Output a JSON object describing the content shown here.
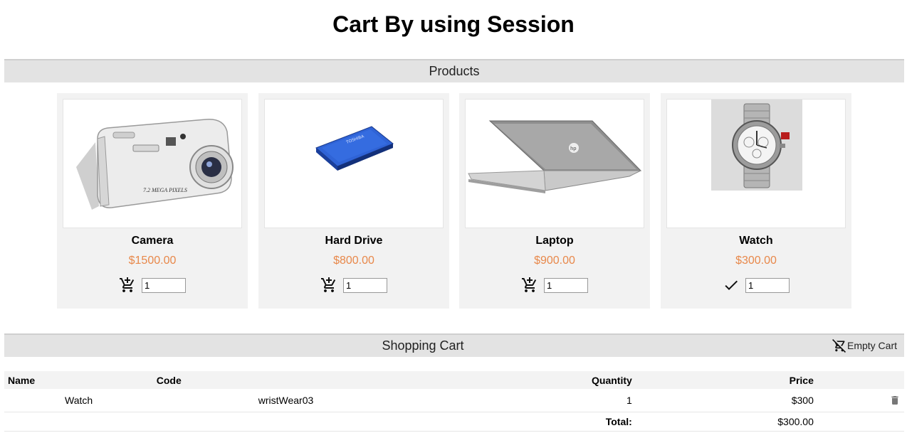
{
  "page": {
    "title": "Cart By using Session"
  },
  "products_section": {
    "title": "Products"
  },
  "products": [
    {
      "name": "Camera",
      "price": "$1500.00",
      "quantity": "1",
      "action_icon": "add-to-cart-icon"
    },
    {
      "name": "Hard Drive",
      "price": "$800.00",
      "quantity": "1",
      "action_icon": "add-to-cart-icon"
    },
    {
      "name": "Laptop",
      "price": "$900.00",
      "quantity": "1",
      "action_icon": "add-to-cart-icon"
    },
    {
      "name": "Watch",
      "price": "$300.00",
      "quantity": "1",
      "action_icon": "checkmark-icon"
    }
  ],
  "cart_section": {
    "title": "Shopping Cart",
    "empty_label": "Empty Cart"
  },
  "cart_table": {
    "headers": {
      "name": "Name",
      "code": "Code",
      "quantity": "Quantity",
      "price": "Price"
    },
    "rows": [
      {
        "name": "Watch",
        "code": "wristWear03",
        "quantity": "1",
        "price": "$300"
      }
    ],
    "total_label": "Total:",
    "total_value": "$300.00"
  },
  "colors": {
    "price": "#e8884a",
    "bar": "#e3e3e3",
    "card": "#f2f2f2"
  }
}
